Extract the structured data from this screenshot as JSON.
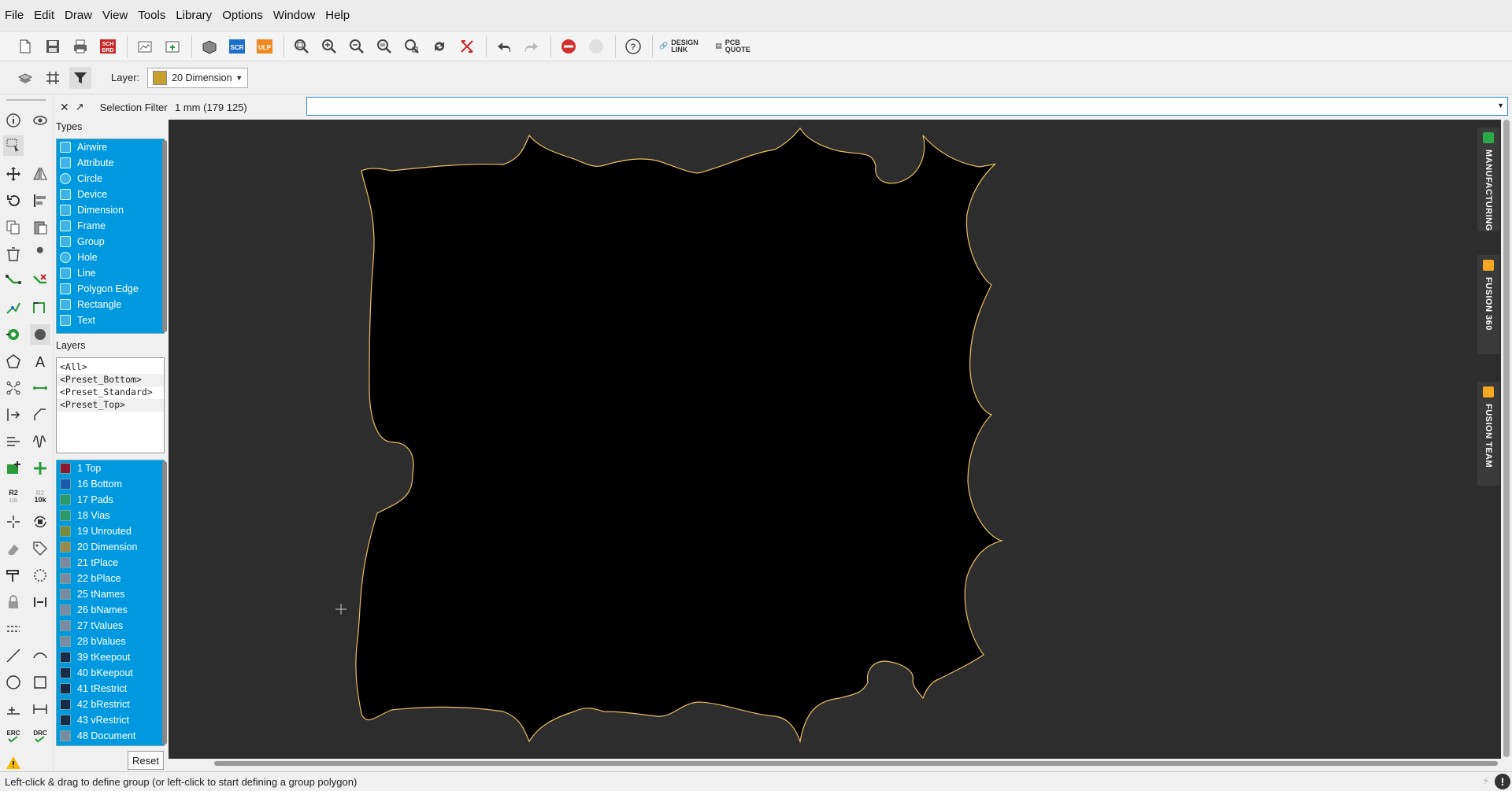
{
  "menu": [
    "File",
    "Edit",
    "Draw",
    "View",
    "Tools",
    "Library",
    "Options",
    "Window",
    "Help"
  ],
  "toolbar": {
    "design_link": "DESIGN LINK",
    "pcb_quote": "PCB QUOTE",
    "sch_brd": "SCH BRD",
    "scr": "SCR",
    "ulp": "ULP"
  },
  "layer_bar": {
    "label": "Layer:",
    "current_layer": "20 Dimension",
    "current_layer_color": "#c8a030"
  },
  "panel": {
    "title": "Selection Filter",
    "types_title": "Types",
    "types": [
      {
        "label": "Airwire",
        "icon": "airwire-icon"
      },
      {
        "label": "Attribute",
        "icon": "tag-icon"
      },
      {
        "label": "Circle",
        "icon": "circle-icon"
      },
      {
        "label": "Device",
        "icon": "device-icon"
      },
      {
        "label": "Dimension",
        "icon": "dimension-icon"
      },
      {
        "label": "Frame",
        "icon": "frame-icon"
      },
      {
        "label": "Group",
        "icon": "group-icon"
      },
      {
        "label": "Hole",
        "icon": "hole-icon"
      },
      {
        "label": "Line",
        "icon": "line-icon"
      },
      {
        "label": "Polygon Edge",
        "icon": "polygon-icon"
      },
      {
        "label": "Rectangle",
        "icon": "rectangle-icon"
      },
      {
        "label": "Text",
        "icon": "text-icon"
      }
    ],
    "layers_title": "Layers",
    "presets": [
      "<All>",
      "<Preset_Bottom>",
      "<Preset_Standard>",
      "<Preset_Top>"
    ],
    "layers": [
      {
        "label": "1 Top",
        "color": "#8b1a2e"
      },
      {
        "label": "16 Bottom",
        "color": "#1a5bb0"
      },
      {
        "label": "17 Pads",
        "color": "#2a9a6a"
      },
      {
        "label": "18 Vias",
        "color": "#2a9a6a"
      },
      {
        "label": "19 Unrouted",
        "color": "#7a8a3a"
      },
      {
        "label": "20 Dimension",
        "color": "#9a8a4a"
      },
      {
        "label": "21 tPlace",
        "color": "#7a8aa0"
      },
      {
        "label": "22 bPlace",
        "color": "#7a8aa0"
      },
      {
        "label": "25 tNames",
        "color": "#7a8aa0"
      },
      {
        "label": "26 bNames",
        "color": "#7a8aa0"
      },
      {
        "label": "27 tValues",
        "color": "#7a8aa0"
      },
      {
        "label": "28 bValues",
        "color": "#7a8aa0"
      },
      {
        "label": "39 tKeepout",
        "color": "#1a2a4a"
      },
      {
        "label": "40 bKeepout",
        "color": "#1a2a4a"
      },
      {
        "label": "41 tRestrict",
        "color": "#1a2a4a"
      },
      {
        "label": "42 bRestrict",
        "color": "#1a2a4a"
      },
      {
        "label": "43 vRestrict",
        "color": "#1a2a4a"
      },
      {
        "label": "48 Document",
        "color": "#7a8aa0"
      }
    ],
    "reset_label": "Reset"
  },
  "command": {
    "coords": "1 mm (179 125)",
    "value": ""
  },
  "dock": {
    "manufacturing": "MANUFACTURING",
    "fusion360": "FUSION 360",
    "fusion_team": "FUSION TEAM"
  },
  "status": {
    "message": "Left-click & drag to define group (or left-click to start defining a group polygon)"
  },
  "colors": {
    "board_outline": "#e8c060",
    "canvas_bg": "#2d2d2d",
    "board_fill": "#000000",
    "selection_blue": "#0099e0"
  }
}
